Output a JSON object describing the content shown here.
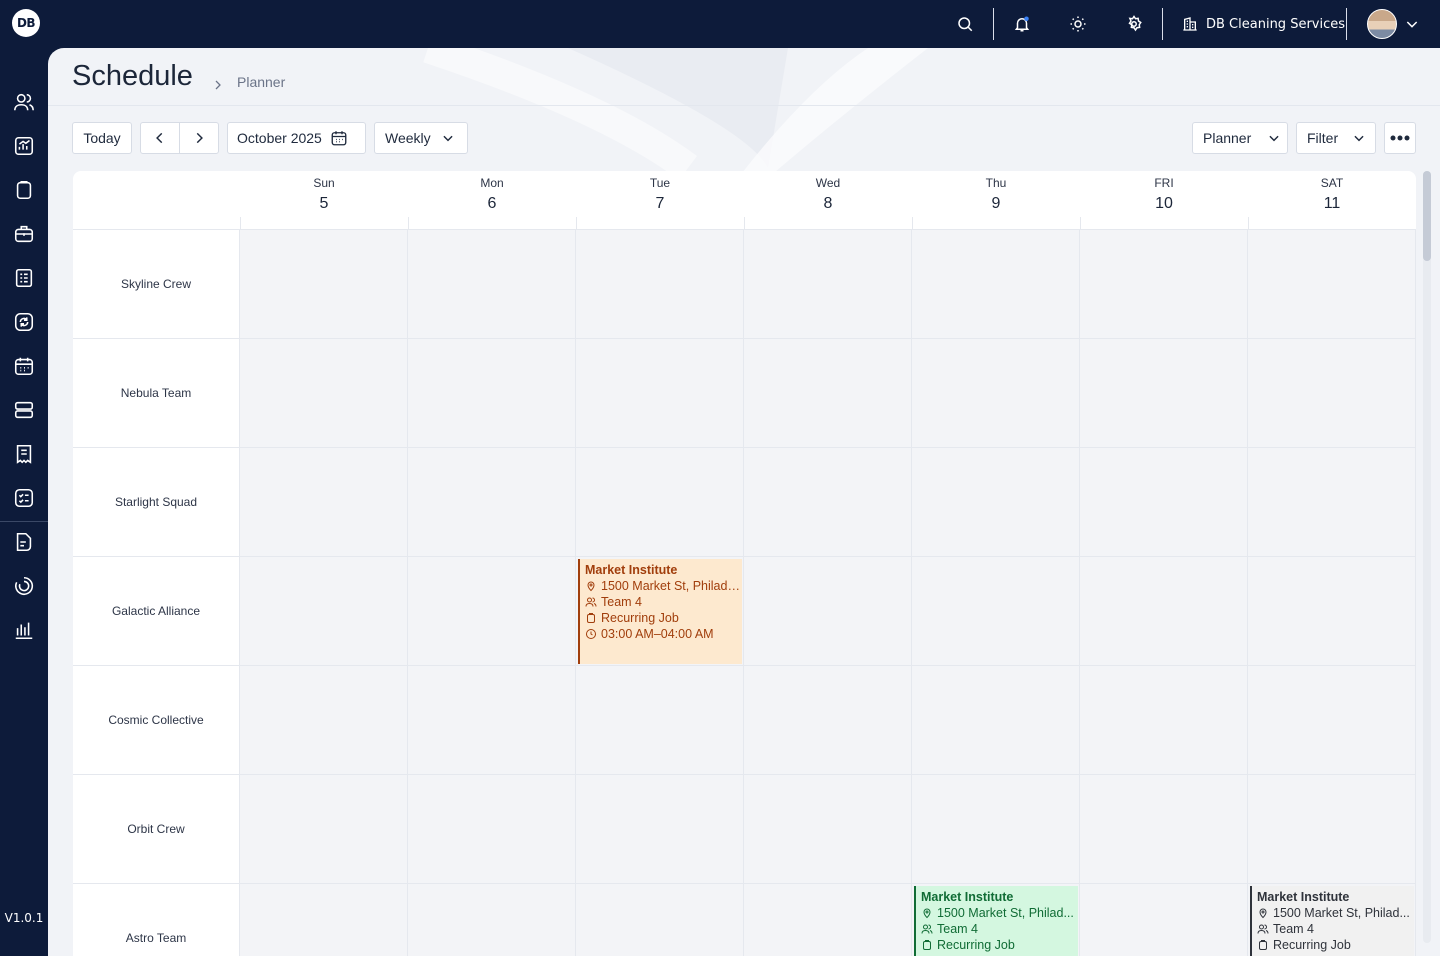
{
  "topbar": {
    "logo_text": "DB",
    "company_name": "DB Cleaning Services",
    "icons": [
      "search-icon",
      "bell-icon",
      "sun-icon",
      "gear-icon",
      "building-icon",
      "chevron-down-icon"
    ]
  },
  "sidebar": {
    "icons": [
      "users-icon",
      "analytics-icon",
      "clipboard-icon",
      "briefcase-icon",
      "document-list-icon",
      "refresh-icon",
      "calendar-icon",
      "server-icon",
      "receipt-icon",
      "checklist-icon",
      "file-edit-icon",
      "spinner-icon",
      "bar-chart-icon"
    ],
    "version": "V1.0.1"
  },
  "header": {
    "title": "Schedule",
    "breadcrumb": "Planner"
  },
  "toolbar": {
    "today_label": "Today",
    "month_label": "October 2025",
    "view_label": "Weekly",
    "planner_label": "Planner",
    "filter_label": "Filter"
  },
  "calendar": {
    "days": [
      {
        "name": "Sun",
        "num": "5"
      },
      {
        "name": "Mon",
        "num": "6"
      },
      {
        "name": "Tue",
        "num": "7"
      },
      {
        "name": "Wed",
        "num": "8"
      },
      {
        "name": "Thu",
        "num": "9"
      },
      {
        "name": "FRI",
        "num": "10"
      },
      {
        "name": "SAT",
        "num": "11"
      }
    ],
    "teams": [
      "Skyline Crew",
      "Nebula Team",
      "Starlight Squad",
      "Galactic Alliance",
      "Cosmic Collective",
      "Orbit Crew",
      "Astro Team"
    ],
    "events": [
      {
        "row": 3,
        "col": 2,
        "title": "Market Institute",
        "address": "1500 Market St, Philadelp...",
        "team": "Team 4",
        "type": "Recurring Job",
        "time": "03:00 AM–04:00 AM",
        "bg": "#fde9cf",
        "fg": "#a13e0c",
        "border": "#a13e0c"
      },
      {
        "row": 6,
        "col": 4,
        "title": "Market Institute",
        "address": "1500 Market St, Philad...",
        "team": "Team 4",
        "type": "Recurring Job",
        "time": "",
        "bg": "#d4f7e0",
        "fg": "#106c35",
        "border": "#106c35"
      },
      {
        "row": 6,
        "col": 6,
        "title": "Market Institute",
        "address": "1500 Market St, Philad...",
        "team": "Team 4",
        "type": "Recurring Job",
        "time": "",
        "bg": "#f1f1f1",
        "fg": "#2f333b",
        "border": "#2f333b"
      }
    ]
  }
}
